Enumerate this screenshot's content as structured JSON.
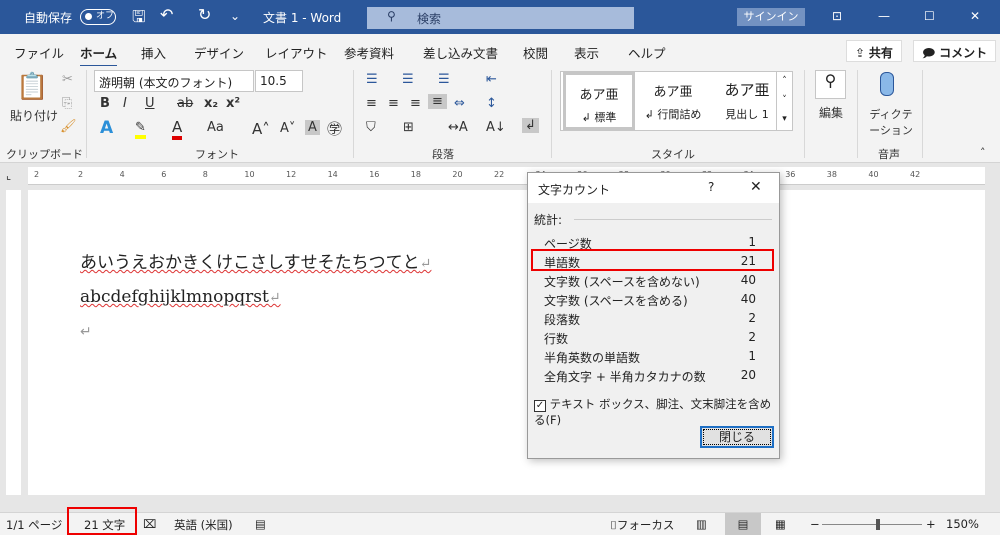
{
  "titlebar": {
    "autosave": "自動保存",
    "toggle": "オフ",
    "doc_title": "文書 1  -  Word",
    "search_placeholder": "検索",
    "signin": "サインイン"
  },
  "tabs": [
    "ファイル",
    "ホーム",
    "挿入",
    "デザイン",
    "レイアウト",
    "参考資料",
    "差し込み文書",
    "校閲",
    "表示",
    "ヘルプ"
  ],
  "share": "共有",
  "comment": "コメント",
  "ribbon": {
    "clipboard": {
      "paste": "貼り付け",
      "label": "クリップボード"
    },
    "font": {
      "name": "游明朝 (本文のフォント)",
      "size": "10.5",
      "label": "フォント"
    },
    "paragraph": {
      "label": "段落"
    },
    "styles": {
      "label": "スタイル",
      "items": [
        {
          "sample": "あア亜",
          "name": "↲ 標準"
        },
        {
          "sample": "あア亜",
          "name": "↲ 行間詰め"
        },
        {
          "sample": "あア亜",
          "name": "見出し 1"
        }
      ]
    },
    "edit": "編集",
    "dictation": "ディクテーション",
    "voice": "音声"
  },
  "ruler": [
    "2",
    "2",
    "4",
    "6",
    "8",
    "10",
    "12",
    "14",
    "16",
    "18",
    "20",
    "22",
    "24",
    "26",
    "28",
    "30",
    "32",
    "34",
    "36",
    "38",
    "40",
    "42"
  ],
  "document": {
    "line1": "あいうえおかきくけこさしすせそたちつてと",
    "line2": "abcdefghijklmnopqrst"
  },
  "dialog": {
    "title": "文字カウント",
    "help": "?",
    "section": "統計:",
    "stats": [
      {
        "label": "ページ数",
        "value": "1"
      },
      {
        "label": "単語数",
        "value": "21"
      },
      {
        "label": "文字数 (スペースを含めない)",
        "value": "40"
      },
      {
        "label": "文字数 (スペースを含める)",
        "value": "40"
      },
      {
        "label": "段落数",
        "value": "2"
      },
      {
        "label": "行数",
        "value": "2"
      },
      {
        "label": "半角英数の単語数",
        "value": "1"
      },
      {
        "label": "全角文字 + 半角カタカナの数",
        "value": "20"
      }
    ],
    "checkbox": "テキスト ボックス、脚注、文末脚注を含める(F)",
    "checked": true,
    "close": "閉じる"
  },
  "status": {
    "page": "1/1 ページ",
    "words": "21 文字",
    "language": "英語 (米国)",
    "focus": "フォーカス",
    "zoom": "150%",
    "zoom_percent": 150
  },
  "colors": {
    "brand": "#2b579a",
    "highlight": "#e00000"
  }
}
